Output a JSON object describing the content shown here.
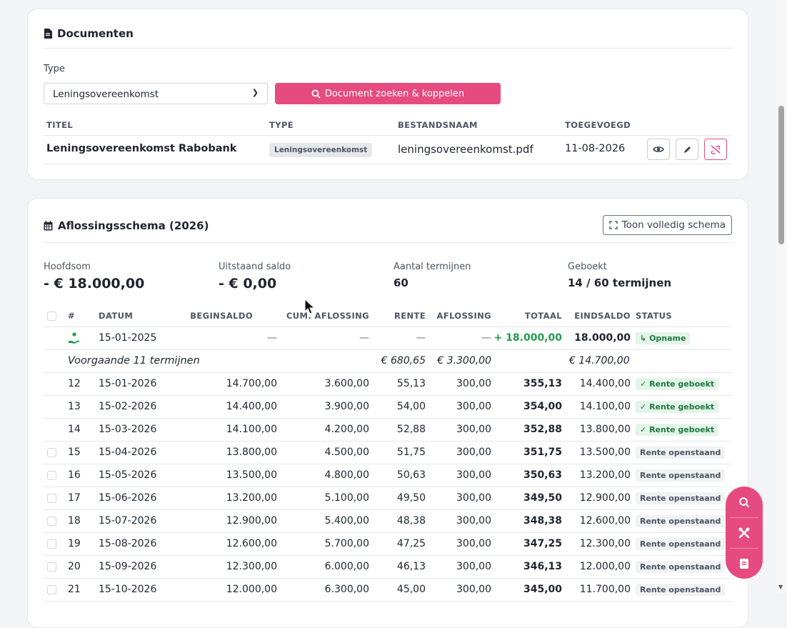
{
  "documents": {
    "title": "Documenten",
    "type_label": "Type",
    "type_value": "Leningsovereenkomst",
    "search_button": "Document zoeken & koppelen",
    "headers": {
      "title": "TITEL",
      "type": "TYPE",
      "filename": "BESTANDSNAAM",
      "added": "TOEGEVOEGD"
    },
    "row": {
      "title": "Leningsovereenkomst Rabobank",
      "type": "Leningsovereenkomst",
      "filename": "leningsovereenkomst.pdf",
      "added": "11-08-2026"
    }
  },
  "schedule": {
    "title": "Aflossingsschema (2026)",
    "full_button": "Toon volledig schema",
    "summary": {
      "principal_label": "Hoofdsom",
      "principal_value": "- € 18.000,00",
      "outstanding_label": "Uitstaand saldo",
      "outstanding_value": "- € 0,00",
      "terms_label": "Aantal termijnen",
      "terms_value": "60",
      "booked_label": "Geboekt",
      "booked_value": "14 / 60 termijnen"
    },
    "headers": {
      "nr": "#",
      "date": "DATUM",
      "begin": "BEGINSALDO",
      "cum": "CUM. AFLOSSING",
      "interest": "RENTE",
      "repay": "AFLOSSING",
      "total": "TOTAAL",
      "end": "EINDSALDO",
      "status": "STATUS"
    },
    "withdrawal": {
      "date": "15-01-2025",
      "begin": "—",
      "cum": "—",
      "interest": "—",
      "repay": "—",
      "total": "+ 18.000,00",
      "end": "18.000,00",
      "status": "Opname"
    },
    "previous": {
      "label": "Voorgaande 11 termijnen",
      "interest": "€ 680,65",
      "repay": "€ 3.300,00",
      "end": "€ 14.700,00"
    },
    "rows": [
      {
        "nr": "12",
        "date": "15-01-2026",
        "begin": "14.700,00",
        "cum": "3.600,00",
        "interest": "55,13",
        "repay": "300,00",
        "total": "355,13",
        "end": "14.400,00",
        "status": "Rente geboekt",
        "booked": true
      },
      {
        "nr": "13",
        "date": "15-02-2026",
        "begin": "14.400,00",
        "cum": "3.900,00",
        "interest": "54,00",
        "repay": "300,00",
        "total": "354,00",
        "end": "14.100,00",
        "status": "Rente geboekt",
        "booked": true
      },
      {
        "nr": "14",
        "date": "15-03-2026",
        "begin": "14.100,00",
        "cum": "4.200,00",
        "interest": "52,88",
        "repay": "300,00",
        "total": "352,88",
        "end": "13.800,00",
        "status": "Rente geboekt",
        "booked": true
      },
      {
        "nr": "15",
        "date": "15-04-2026",
        "begin": "13.800,00",
        "cum": "4.500,00",
        "interest": "51,75",
        "repay": "300,00",
        "total": "351,75",
        "end": "13.500,00",
        "status": "Rente openstaand",
        "booked": false
      },
      {
        "nr": "16",
        "date": "15-05-2026",
        "begin": "13.500,00",
        "cum": "4.800,00",
        "interest": "50,63",
        "repay": "300,00",
        "total": "350,63",
        "end": "13.200,00",
        "status": "Rente openstaand",
        "booked": false
      },
      {
        "nr": "17",
        "date": "15-06-2026",
        "begin": "13.200,00",
        "cum": "5.100,00",
        "interest": "49,50",
        "repay": "300,00",
        "total": "349,50",
        "end": "12.900,00",
        "status": "Rente openstaand",
        "booked": false
      },
      {
        "nr": "18",
        "date": "15-07-2026",
        "begin": "12.900,00",
        "cum": "5.400,00",
        "interest": "48,38",
        "repay": "300,00",
        "total": "348,38",
        "end": "12.600,00",
        "status": "Rente openstaand",
        "booked": false
      },
      {
        "nr": "19",
        "date": "15-08-2026",
        "begin": "12.600,00",
        "cum": "5.700,00",
        "interest": "47,25",
        "repay": "300,00",
        "total": "347,25",
        "end": "12.300,00",
        "status": "Rente openstaand",
        "booked": false
      },
      {
        "nr": "20",
        "date": "15-09-2026",
        "begin": "12.300,00",
        "cum": "6.000,00",
        "interest": "46,13",
        "repay": "300,00",
        "total": "346,13",
        "end": "12.000,00",
        "status": "Rente openstaand",
        "booked": false
      },
      {
        "nr": "21",
        "date": "15-10-2026",
        "begin": "12.000,00",
        "cum": "6.300,00",
        "interest": "45,00",
        "repay": "300,00",
        "total": "345,00",
        "end": "11.700,00",
        "status": "Rente openstaand",
        "booked": false
      }
    ]
  },
  "colors": {
    "accent": "#e64b7f",
    "positive": "#1f9d4c",
    "booked_bg": "#e3f4e8"
  }
}
